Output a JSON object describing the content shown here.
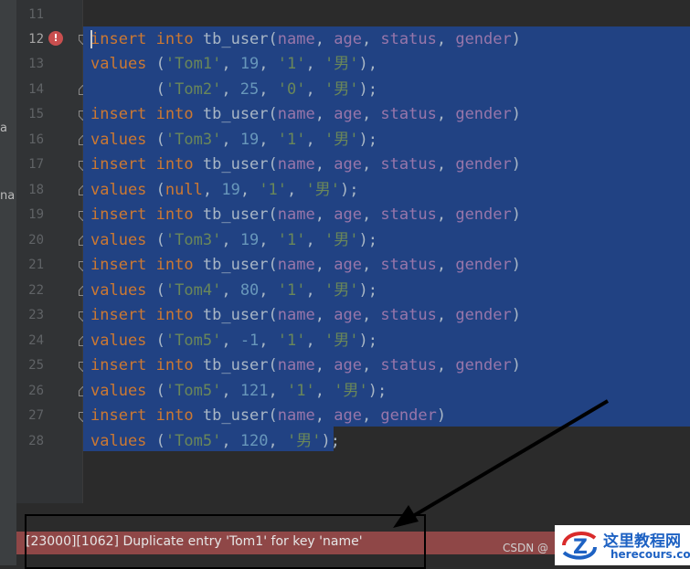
{
  "side_panel": {
    "label_a": "a",
    "label_na": "na"
  },
  "gutter": {
    "line_numbers": [
      "11",
      "12",
      "13",
      "14",
      "15",
      "16",
      "17",
      "18",
      "19",
      "20",
      "21",
      "22",
      "23",
      "24",
      "25",
      "26",
      "27",
      "28"
    ],
    "current_line": "12"
  },
  "code": {
    "l12": {
      "kw1": "insert",
      "kw2": "into",
      "table": "tb_user",
      "c1": "name",
      "c2": "age",
      "c3": "status",
      "c4": "gender"
    },
    "l13": {
      "kw": "values",
      "s1": "'Tom1'",
      "n": "19",
      "s2": "'1'",
      "s3": "'男'"
    },
    "l14": {
      "s1": "'Tom2'",
      "n": "25",
      "s2": "'0'",
      "s3": "'男'"
    },
    "l15": {
      "kw1": "insert",
      "kw2": "into",
      "table": "tb_user",
      "c1": "name",
      "c2": "age",
      "c3": "status",
      "c4": "gender"
    },
    "l16": {
      "kw": "values",
      "s1": "'Tom3'",
      "n": "19",
      "s2": "'1'",
      "s3": "'男'"
    },
    "l17": {
      "kw1": "insert",
      "kw2": "into",
      "table": "tb_user",
      "c1": "name",
      "c2": "age",
      "c3": "status",
      "c4": "gender"
    },
    "l18": {
      "kw": "values",
      "nul": "null",
      "n": "19",
      "s2": "'1'",
      "s3": "'男'"
    },
    "l19": {
      "kw1": "insert",
      "kw2": "into",
      "table": "tb_user",
      "c1": "name",
      "c2": "age",
      "c3": "status",
      "c4": "gender"
    },
    "l20": {
      "kw": "values",
      "s1": "'Tom3'",
      "n": "19",
      "s2": "'1'",
      "s3": "'男'"
    },
    "l21": {
      "kw1": "insert",
      "kw2": "into",
      "table": "tb_user",
      "c1": "name",
      "c2": "age",
      "c3": "status",
      "c4": "gender"
    },
    "l22": {
      "kw": "values",
      "s1": "'Tom4'",
      "n": "80",
      "s2": "'1'",
      "s3": "'男'"
    },
    "l23": {
      "kw1": "insert",
      "kw2": "into",
      "table": "tb_user",
      "c1": "name",
      "c2": "age",
      "c3": "status",
      "c4": "gender"
    },
    "l24": {
      "kw": "values",
      "s1": "'Tom5'",
      "n": "-1",
      "s2": "'1'",
      "s3": "'男'"
    },
    "l25": {
      "kw1": "insert",
      "kw2": "into",
      "table": "tb_user",
      "c1": "name",
      "c2": "age",
      "c3": "status",
      "c4": "gender"
    },
    "l26": {
      "kw": "values",
      "s1": "'Tom5'",
      "n": "121",
      "s2": "'1'",
      "s3": "'男'"
    },
    "l27": {
      "kw1": "insert",
      "kw2": "into",
      "table": "tb_user",
      "c1": "name",
      "c2": "age",
      "c3": "gender"
    },
    "l28": {
      "kw": "values",
      "s1": "'Tom5'",
      "n": "120",
      "s3": "'男'"
    }
  },
  "error_bar": {
    "message": "[23000][1062] Duplicate entry 'Tom1' for key 'name'"
  },
  "watermark": {
    "csdn": "CSDN @",
    "title": "这里教程网",
    "url": "herecours.com"
  },
  "colors": {
    "editor_bg": "#2b2b2b",
    "selection": "#214283",
    "keyword": "#cc7832",
    "column": "#9876aa",
    "string": "#6a8759",
    "number": "#6897bb",
    "error_bar": "#8f4747"
  }
}
